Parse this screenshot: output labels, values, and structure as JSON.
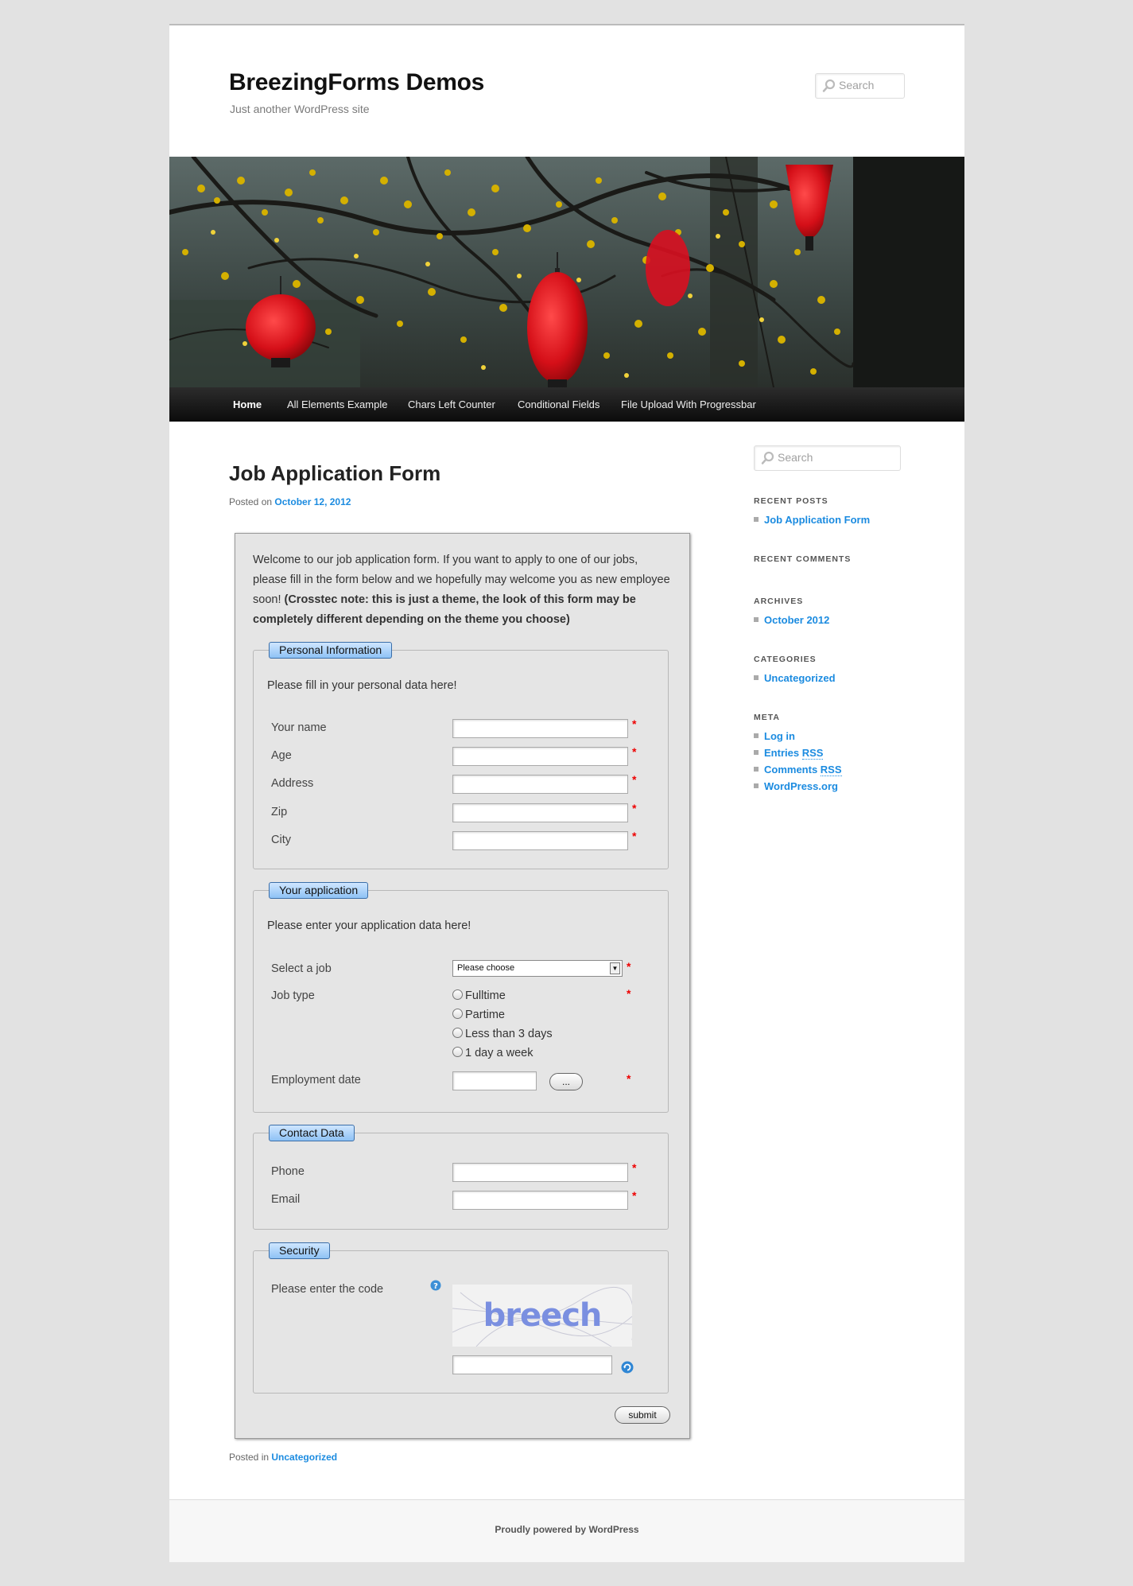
{
  "site": {
    "title": "BreezingForms Demos",
    "description": "Just another WordPress site",
    "search_placeholder": "Search"
  },
  "nav": {
    "items": [
      {
        "label": "Home",
        "active": true
      },
      {
        "label": "All Elements Example",
        "active": false
      },
      {
        "label": "Chars Left Counter",
        "active": false
      },
      {
        "label": "Conditional Fields",
        "active": false
      },
      {
        "label": "File Upload With Progressbar",
        "active": false
      }
    ]
  },
  "post": {
    "title": "Job Application Form",
    "posted_on_label": "Posted on",
    "date": "October 12, 2012",
    "posted_in_label": "Posted in",
    "category": "Uncategorized"
  },
  "form": {
    "intro_normal": "Welcome to our job application form. If you want to apply to one of our jobs, please fill in the form below and we hopefully may welcome you as new employee soon! ",
    "intro_bold": "(Crosstec note: this is just a theme, the look of this form may be completely different depending on the theme you choose)",
    "required_mark": "*",
    "personal": {
      "legend": "Personal Information",
      "description": "Please fill in your personal data here!",
      "fields": [
        {
          "label": "Your name",
          "value": ""
        },
        {
          "label": "Age",
          "value": ""
        },
        {
          "label": "Address",
          "value": ""
        },
        {
          "label": "Zip",
          "value": ""
        },
        {
          "label": "City",
          "value": ""
        }
      ]
    },
    "application": {
      "legend": "Your application",
      "description": "Please enter your application data here!",
      "select_job_label": "Select a job",
      "select_job_value": "Please choose",
      "job_type_label": "Job type",
      "job_type_options": [
        "Fulltime",
        "Partime",
        "Less than 3 days",
        "1 day a week"
      ],
      "employment_date_label": "Employment date",
      "date_button": "..."
    },
    "contact": {
      "legend": "Contact Data",
      "fields": [
        {
          "label": "Phone",
          "value": ""
        },
        {
          "label": "Email",
          "value": ""
        }
      ]
    },
    "security": {
      "legend": "Security",
      "label": "Please enter the code",
      "captcha_text": "breech",
      "help_icon": "help-icon",
      "refresh_icon": "refresh-icon"
    },
    "submit_label": "submit"
  },
  "sidebar": {
    "search_placeholder": "Search",
    "recent_posts_title": "RECENT POSTS",
    "recent_posts": [
      "Job Application Form"
    ],
    "recent_comments_title": "RECENT COMMENTS",
    "archives_title": "ARCHIVES",
    "archives": [
      "October 2012"
    ],
    "categories_title": "CATEGORIES",
    "categories": [
      "Uncategorized"
    ],
    "meta_title": "META",
    "meta_links": [
      {
        "text": "Log in",
        "rss": ""
      },
      {
        "text": "Entries ",
        "rss": "RSS"
      },
      {
        "text": "Comments ",
        "rss": "RSS"
      },
      {
        "text": "WordPress.org",
        "rss": ""
      }
    ]
  },
  "footer": {
    "text": "Proudly powered by WordPress"
  },
  "colors": {
    "accent": "#1b8be0",
    "lantern": "#e0101c",
    "blossom": "#d8b300",
    "nav_bg": "#1a1a1a",
    "legend_bg": "#8ec2f5"
  }
}
